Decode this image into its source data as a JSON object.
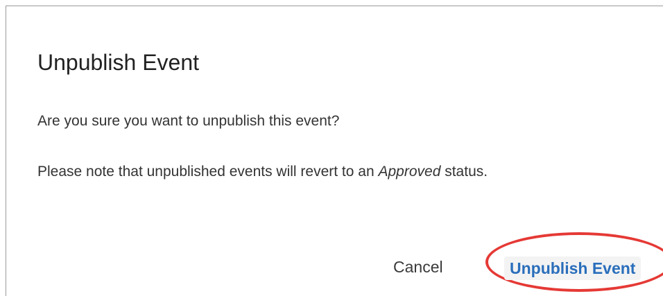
{
  "dialog": {
    "title": "Unpublish Event",
    "message_line1": "Are you sure you want to unpublish this event?",
    "message_line2_prefix": "Please note that unpublished events will revert to an ",
    "message_line2_emphasis": "Approved",
    "message_line2_suffix": " status.",
    "cancel_label": "Cancel",
    "confirm_label": "Unpublish Event"
  },
  "colors": {
    "primary_text": "#2a6ebb",
    "highlight_ring": "#e53935",
    "title_text": "#212121",
    "body_text": "#333333"
  }
}
